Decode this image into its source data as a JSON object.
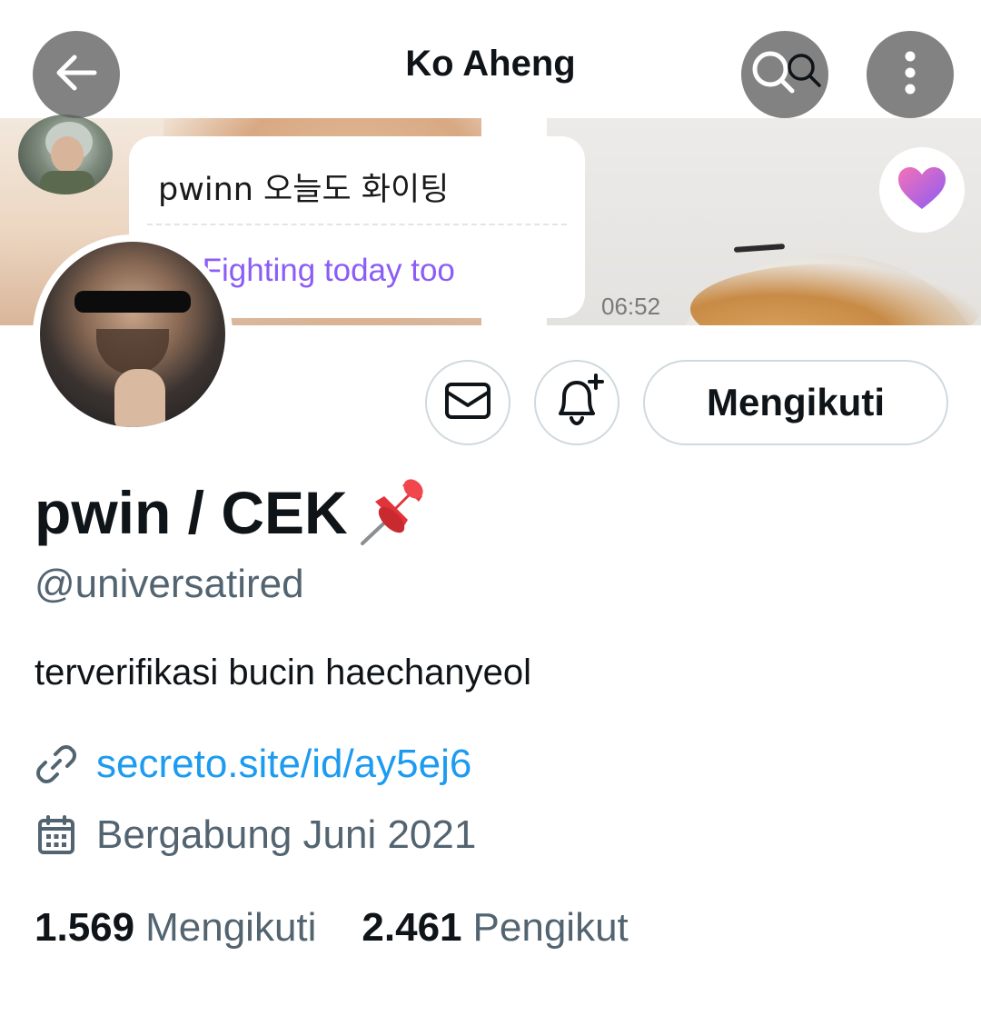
{
  "header": {
    "title": "Ko Aheng"
  },
  "banner": {
    "chat_text_korean": "pwinn 오늘도 화이팅",
    "chat_text_translation": "nn Fighting today too",
    "chat_time": "06:52"
  },
  "actions": {
    "follow_label": "Mengikuti"
  },
  "profile": {
    "display_name": "pwin / CEK",
    "handle": "@universatired",
    "bio": "terverifikasi bucin haechanyeol",
    "link": "secreto.site/id/ay5ej6",
    "joined": "Bergabung Juni 2021"
  },
  "stats": {
    "following_count": "1.569",
    "following_label": "Mengikuti",
    "followers_count": "2.461",
    "followers_label": "Pengikut"
  },
  "colors": {
    "text_primary": "#0f1419",
    "text_secondary": "#536471",
    "link": "#1d9bf0",
    "border": "#cfd9de",
    "overlay_button": "#5f5f5f",
    "chat_accent": "#8b5cf6"
  },
  "icons": {
    "back": "arrow-left-icon",
    "search": "search-icon",
    "more": "more-vertical-icon",
    "heart": "heart-icon",
    "message": "envelope-icon",
    "notifications": "bell-plus-icon",
    "pin": "pushpin-icon",
    "link": "link-icon",
    "calendar": "calendar-icon"
  }
}
